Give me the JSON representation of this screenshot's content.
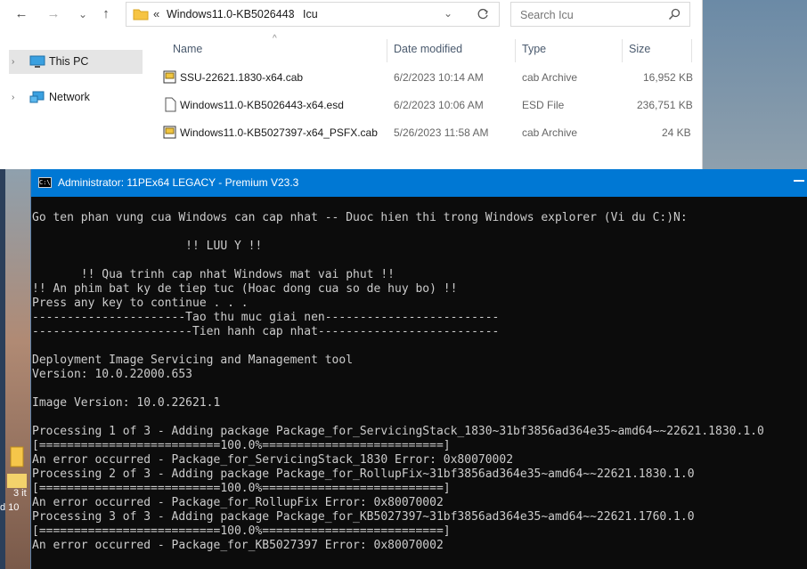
{
  "explorer": {
    "nav": {
      "back": "←",
      "forward": "→",
      "recent": "⌄",
      "up": "↑"
    },
    "address": {
      "chevron": "«",
      "segments": [
        "Windows11.0-KB5026443",
        "Icu"
      ]
    },
    "search_placeholder": "Search Icu",
    "sidebar": [
      {
        "label": "This PC",
        "selected": true
      },
      {
        "label": "Network",
        "selected": false
      }
    ],
    "columns": {
      "name": "Name",
      "date": "Date modified",
      "type": "Type",
      "size": "Size"
    },
    "files": [
      {
        "name": "SSU-22621.1830-x64.cab",
        "date": "6/2/2023 10:14 AM",
        "type": "cab Archive",
        "size": "16,952 KB",
        "icon": "cab-archive-icon"
      },
      {
        "name": "Windows11.0-KB5026443-x64.esd",
        "date": "6/2/2023 10:06 AM",
        "type": "ESD File",
        "size": "236,751 KB",
        "icon": "file-icon"
      },
      {
        "name": "Windows11.0-KB5027397-x64_PSFX.cab",
        "date": "5/26/2023 11:58 AM",
        "type": "cab Archive",
        "size": "24 KB",
        "icon": "cab-archive-icon"
      }
    ]
  },
  "console": {
    "title": "Administrator:  11PEx64 LEGACY - Premium V23.3",
    "lines": [
      "Go ten phan vung cua Windows can cap nhat -- Duoc hien thi trong Windows explorer (Vi du C:)N:",
      "",
      "                      !! LUU Y !!",
      "",
      "       !! Qua trinh cap nhat Windows mat vai phut !!",
      "!! An phim bat ky de tiep tuc (Hoac dong cua so de huy bo) !!",
      "Press any key to continue . . .",
      "----------------------Tao thu muc giai nen-------------------------",
      "-----------------------Tien hanh cap nhat--------------------------",
      "",
      "Deployment Image Servicing and Management tool",
      "Version: 10.0.22000.653",
      "",
      "Image Version: 10.0.22621.1",
      "",
      "Processing 1 of 3 - Adding package Package_for_ServicingStack_1830~31bf3856ad364e35~amd64~~22621.1830.1.0",
      "[==========================100.0%==========================]",
      "An error occurred - Package_for_ServicingStack_1830 Error: 0x80070002",
      "Processing 2 of 3 - Adding package Package_for_RollupFix~31bf3856ad364e35~amd64~~22621.1830.1.0",
      "[==========================100.0%==========================]",
      "An error occurred - Package_for_RollupFix Error: 0x80070002",
      "Processing 3 of 3 - Adding package Package_for_KB5027397~31bf3856ad364e35~amd64~~22621.1760.1.0",
      "[==========================100.0%==========================]",
      "An error occurred - Package_for_KB5027397 Error: 0x80070002"
    ]
  },
  "taskbar_snippet": {
    "line1": "3 it",
    "line2": "d 10"
  },
  "colors": {
    "titlebar": "#0078d4",
    "console_bg": "#0c0c0c",
    "console_text": "#cccccc",
    "selected_row": "#e5e5e5"
  }
}
